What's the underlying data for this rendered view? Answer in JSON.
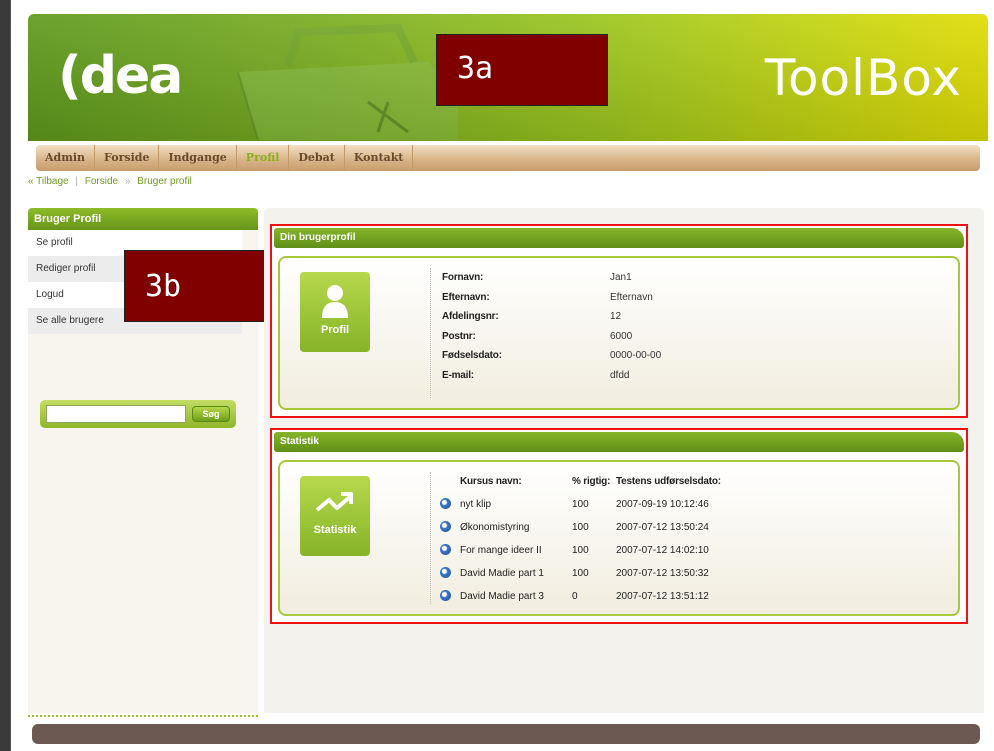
{
  "header": {
    "logo": "(dea",
    "brand": "ToolBox"
  },
  "annotations": {
    "tag_a": "3a",
    "tag_b": "3b"
  },
  "nav": [
    "Admin",
    "Forside",
    "Indgange",
    "Profil",
    "Debat",
    "Kontakt"
  ],
  "nav_active": "Profil",
  "breadcrumb": {
    "back": "« Tilbage",
    "sep1": "|",
    "home": "Forside",
    "sep2": "»",
    "current": "Bruger profil"
  },
  "sidebar": {
    "title": "Bruger Profil",
    "items": [
      "Se profil",
      "Rediger profil",
      "Logud",
      "Se alle brugere"
    ],
    "search_value": "",
    "search_button": "Søg"
  },
  "profile": {
    "title": "Din brugerprofil",
    "icon_label": "Profil",
    "icon": "user-icon",
    "fields": [
      {
        "label": "Fornavn:",
        "value": "Jan1"
      },
      {
        "label": "Efternavn:",
        "value": "Efternavn"
      },
      {
        "label": "Afdelingsnr:",
        "value": "12"
      },
      {
        "label": "Postnr:",
        "value": "6000"
      },
      {
        "label": "Fødselsdato:",
        "value": "0000-00-00"
      },
      {
        "label": "E-mail:",
        "value": "dfdd"
      }
    ]
  },
  "stats": {
    "title": "Statistik",
    "icon_label": "Statistik",
    "icon": "trend-arrow-icon",
    "columns": [
      "Kursus navn:",
      "% rigtig:",
      "Testens udførselsdato:"
    ],
    "rows": [
      {
        "name": "nyt klip",
        "pct": "100",
        "date": "2007-09-19 10:12:46"
      },
      {
        "name": "Økonomistyring",
        "pct": "100",
        "date": "2007-07-12 13:50:24"
      },
      {
        "name": "For mange ideer II",
        "pct": "100",
        "date": "2007-07-12 14:02:10"
      },
      {
        "name": "David Madie part 1",
        "pct": "100",
        "date": "2007-07-12 13:50:32"
      },
      {
        "name": "David Madie part 3",
        "pct": "0",
        "date": "2007-07-12 13:51:12"
      }
    ]
  },
  "colors": {
    "green": "#7bb024",
    "annotation": "#800000",
    "highlight": "#ee1111",
    "nav": "#d9b58a"
  }
}
